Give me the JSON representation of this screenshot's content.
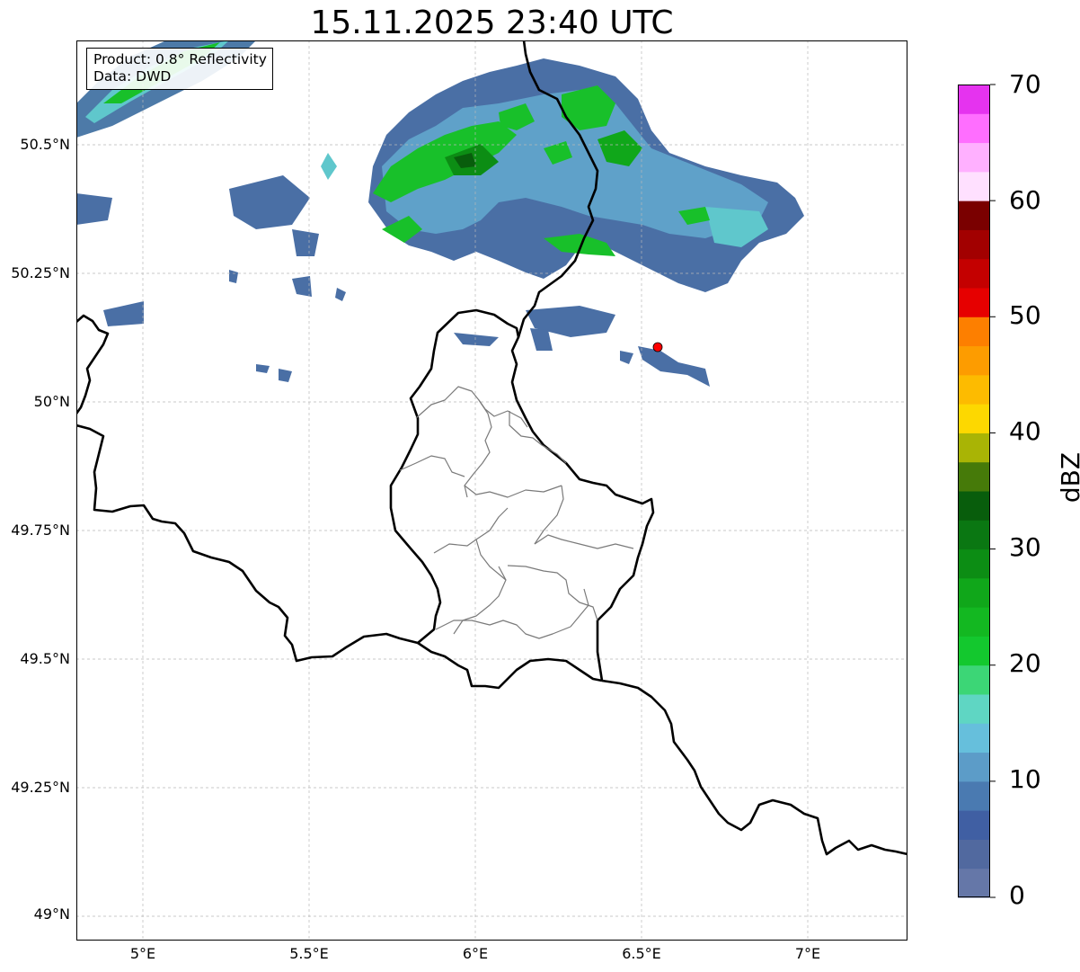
{
  "title": "15.11.2025 23:40 UTC",
  "info_box": {
    "product": "Product: 0.8° Reflectivity",
    "data": "Data: DWD"
  },
  "axes": {
    "lon_range": [
      4.8,
      7.3
    ],
    "lat_range": [
      48.95,
      50.7
    ],
    "lon_ticks": [
      "5°E",
      "5.5°E",
      "6°E",
      "6.5°E",
      "7°E"
    ],
    "lat_ticks": [
      "50.5°N",
      "50.25°N",
      "50°N",
      "49.75°N",
      "49.5°N",
      "49.25°N",
      "49°N"
    ],
    "grid": true
  },
  "radar_site": {
    "lon": 6.548,
    "lat": 50.11,
    "color": "#ff0000"
  },
  "colorbar": {
    "label": "dBZ",
    "tick_labels": [
      "0",
      "10",
      "20",
      "30",
      "40",
      "50",
      "60",
      "70"
    ],
    "range": [
      0,
      70
    ],
    "colors": [
      "#6577a8",
      "#51699f",
      "#405fa3",
      "#4a7ab1",
      "#5c9cc8",
      "#66bfdc",
      "#5fd6c3",
      "#3cd676",
      "#13c82e",
      "#13b821",
      "#10a71a",
      "#0c8d14",
      "#0a7712",
      "#085d0c",
      "#467a09",
      "#a9b405",
      "#fdd800",
      "#fdbb00",
      "#fd9c00",
      "#fd7f00",
      "#e60000",
      "#c40000",
      "#a20000",
      "#7a0000",
      "#ffe0ff",
      "#ffb0ff",
      "#ff6eff",
      "#e533ef"
    ]
  }
}
